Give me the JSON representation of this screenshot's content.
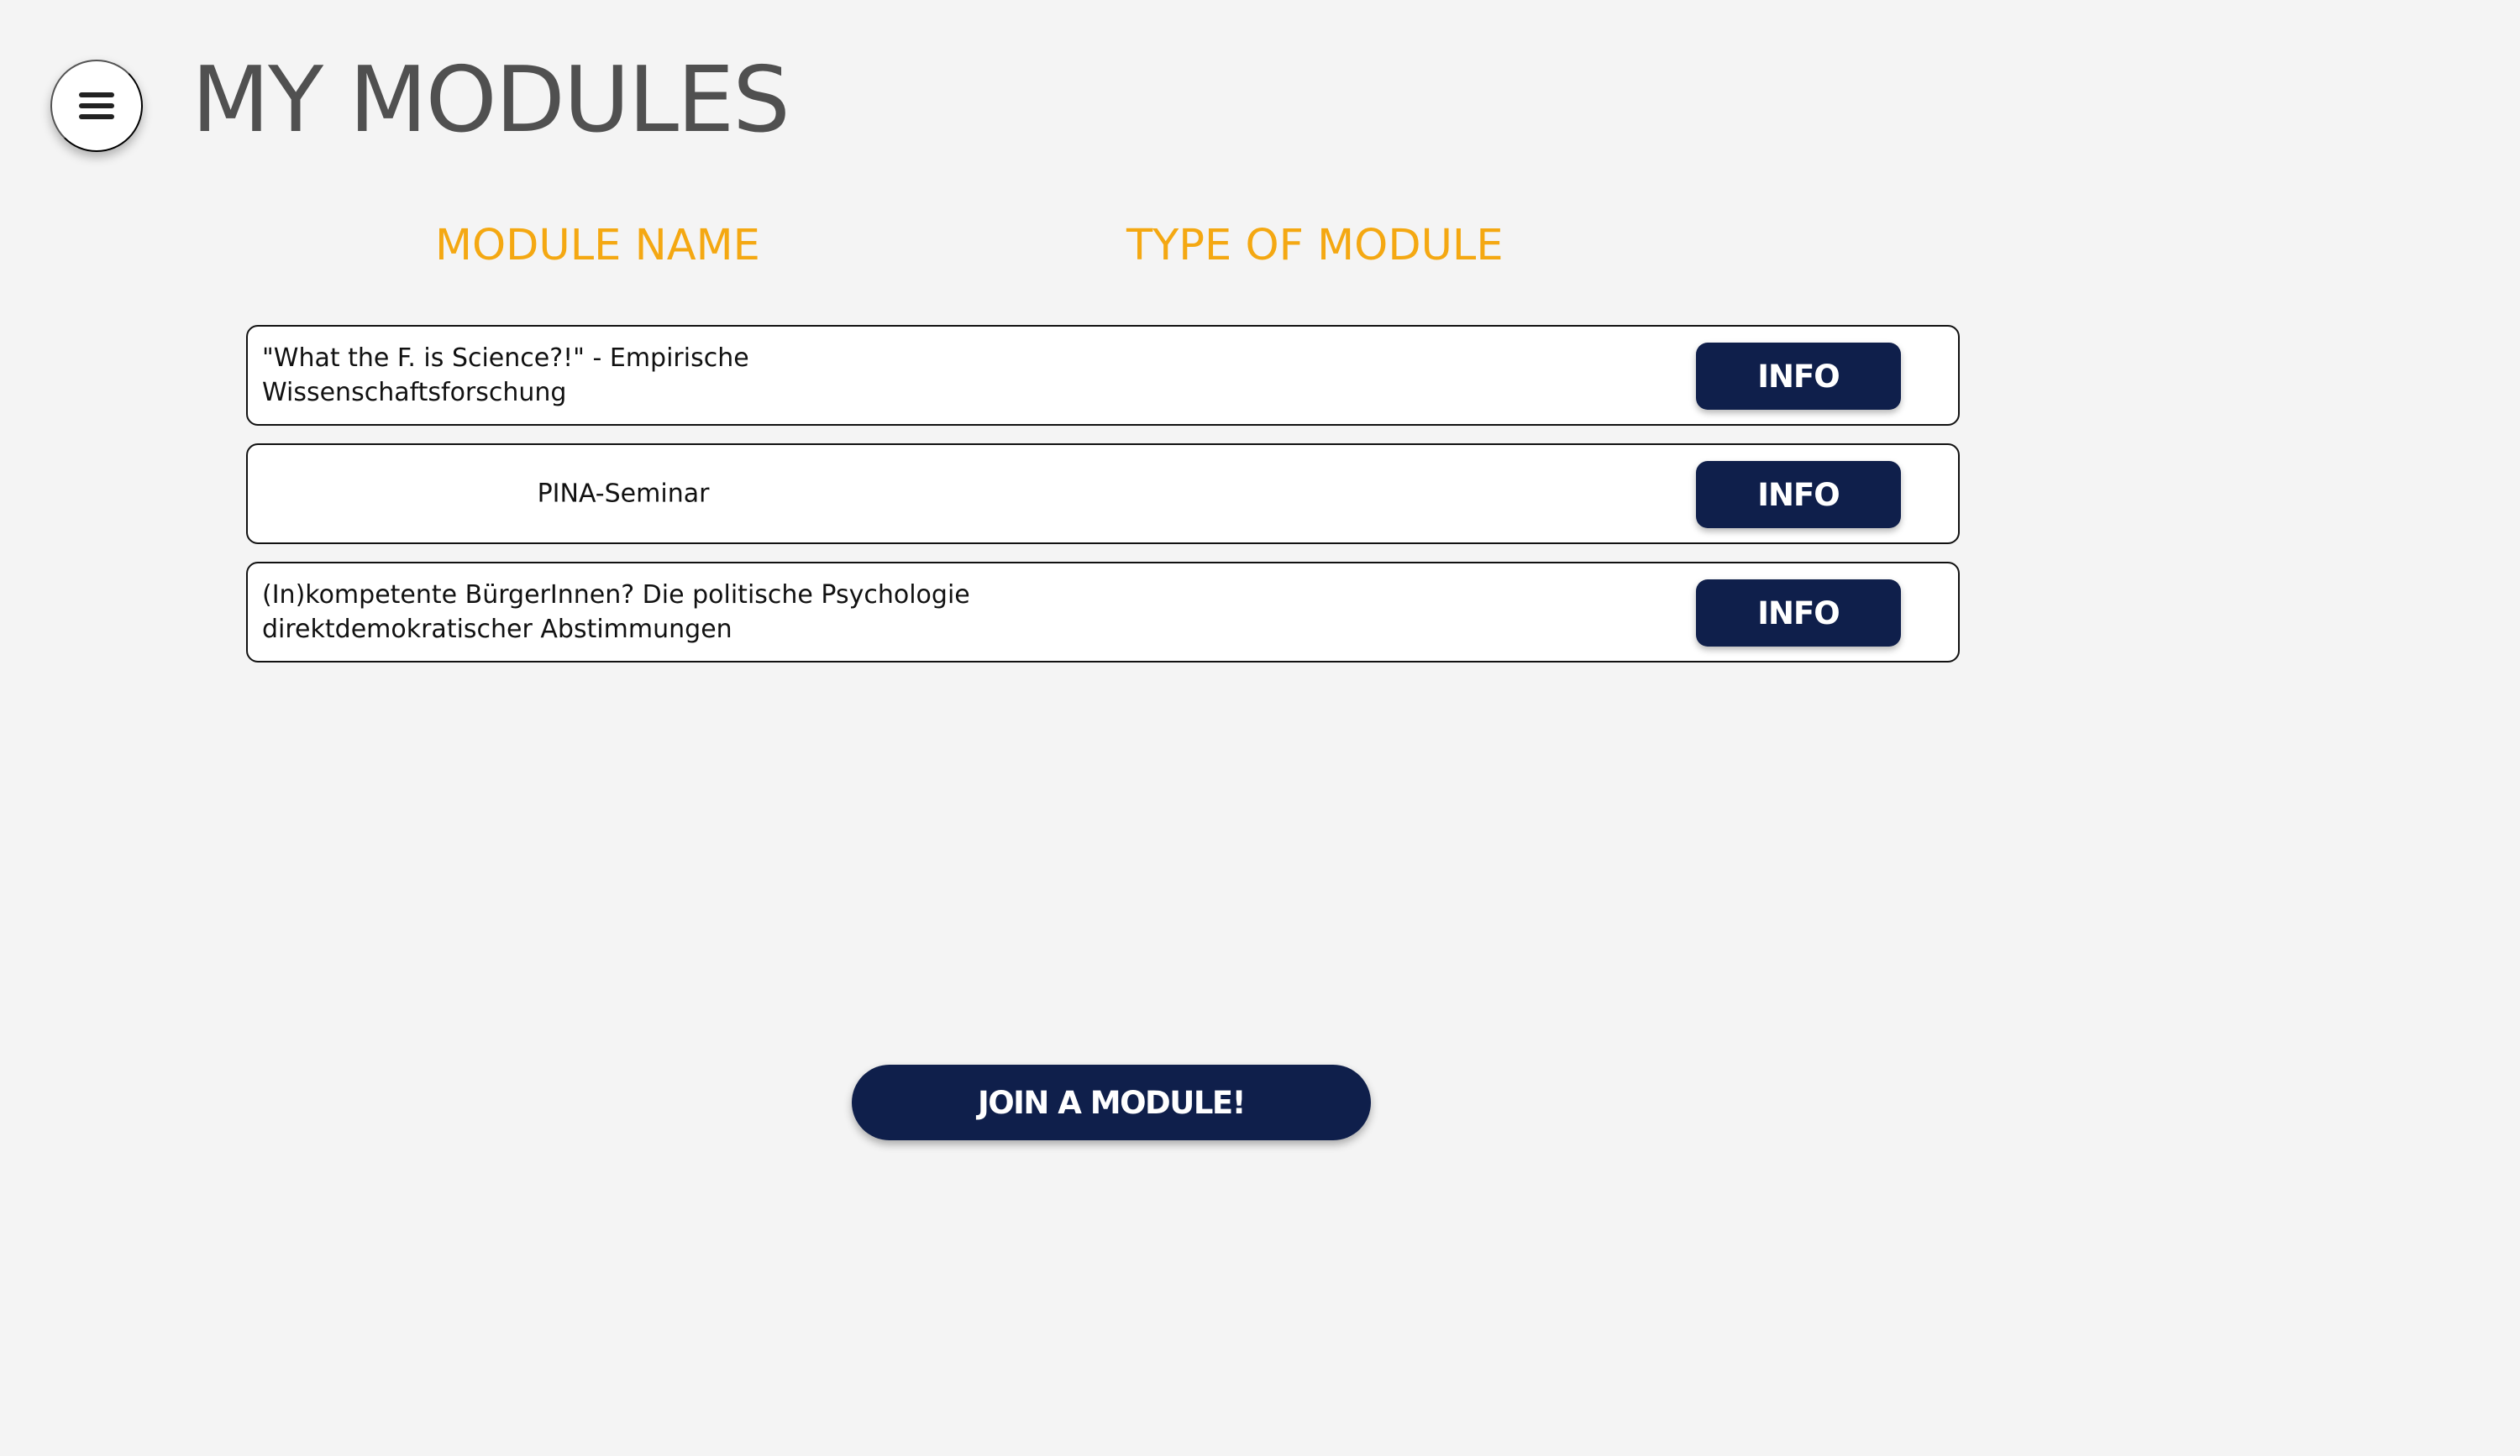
{
  "header": {
    "menu_icon": "hamburger-menu-icon",
    "title": "MY MODULES"
  },
  "table": {
    "columns": [
      "MODULE NAME",
      "TYPE OF MODULE"
    ],
    "rows": [
      {
        "name": "\"What the F. is Science?!\" - Empirische Wissenschaftsforschung",
        "type": "",
        "action_label": "INFO"
      },
      {
        "name": "PINA-Seminar",
        "type": "",
        "action_label": "INFO"
      },
      {
        "name": "(In)kompetente BürgerInnen? Die politische Psychologie direktdemokratischer Abstimmungen",
        "type": "",
        "action_label": "INFO"
      }
    ]
  },
  "actions": {
    "join_label": "JOIN A MODULE!"
  },
  "colors": {
    "background": "#f4f4f4",
    "title": "#505050",
    "accent": "#f4a812",
    "button": "#0f1f4b",
    "button_text": "#ffffff"
  }
}
